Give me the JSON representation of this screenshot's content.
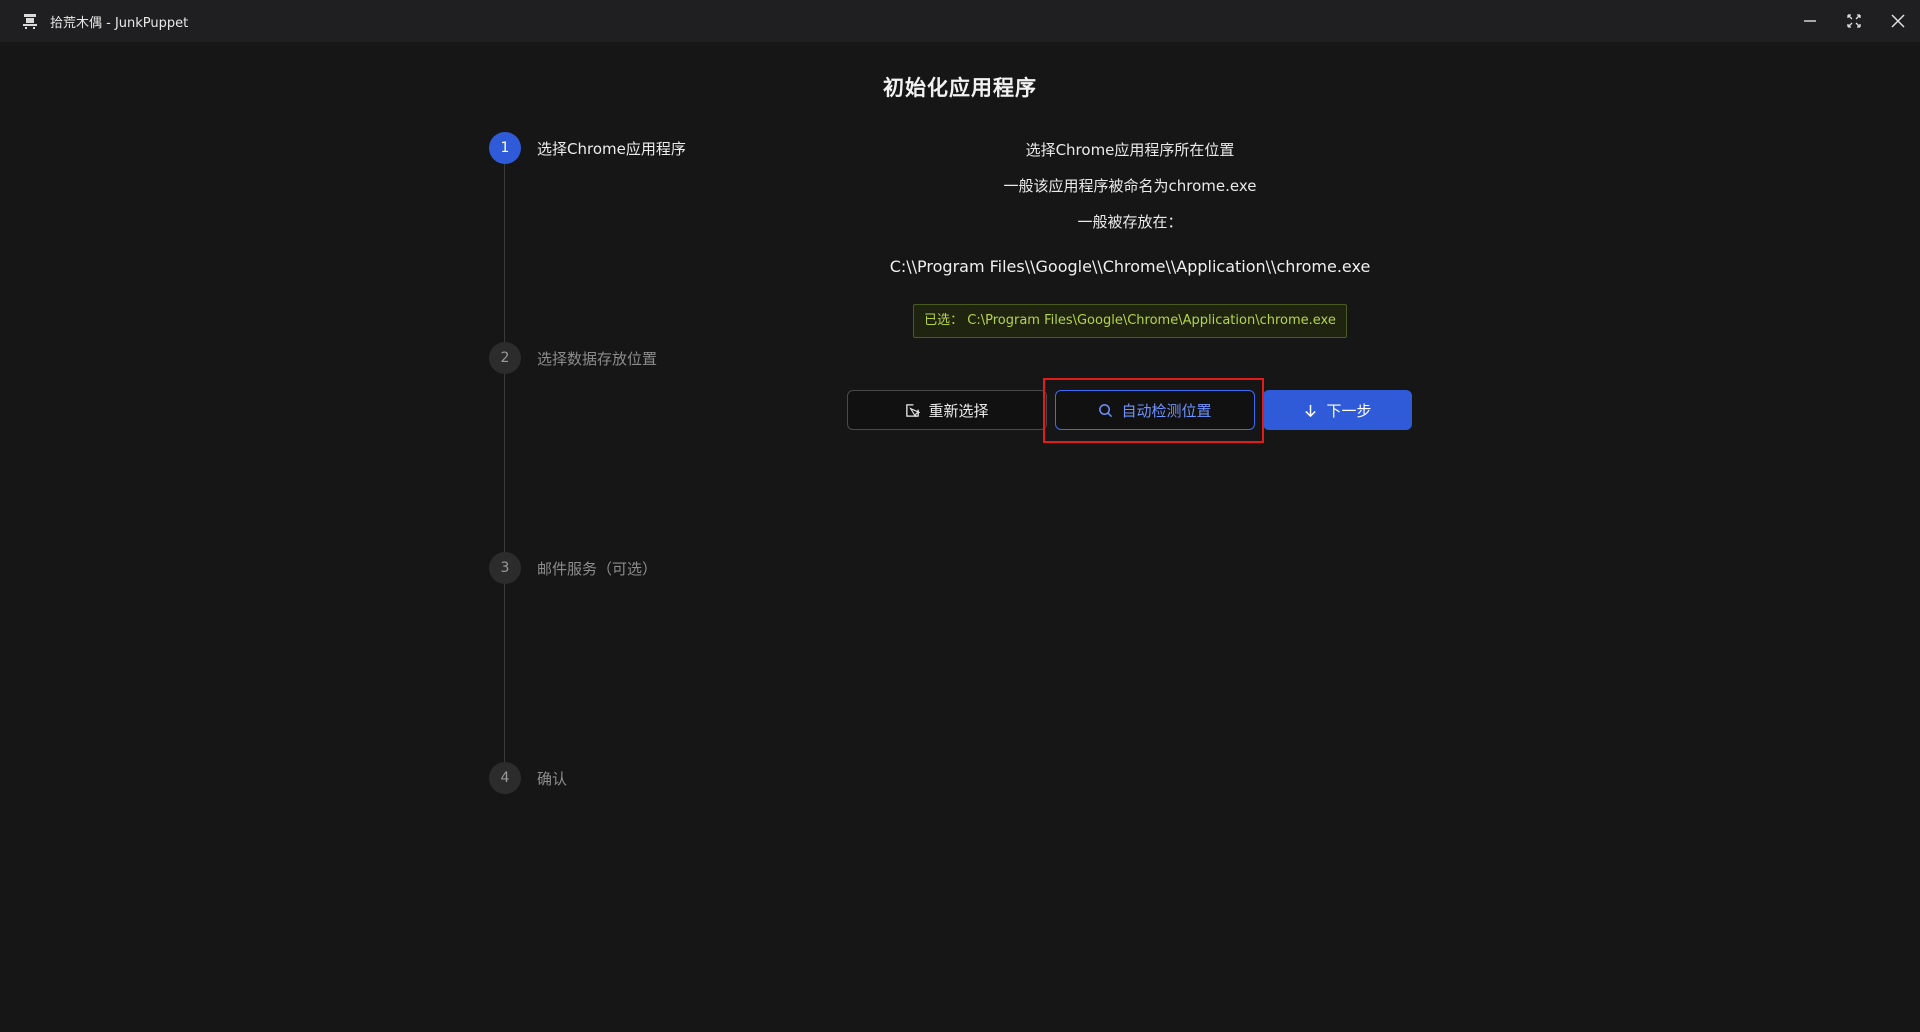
{
  "window": {
    "title": "拾荒木偶 - JunkPuppet",
    "logo_icon": "puppet-logo-icon",
    "controls": [
      "minimize-icon",
      "maximize-icon",
      "close-icon"
    ]
  },
  "page": {
    "title": "初始化应用程序"
  },
  "steps": [
    {
      "number": "1",
      "label": "选择Chrome应用程序",
      "active": true
    },
    {
      "number": "2",
      "label": "选择数据存放位置",
      "active": false
    },
    {
      "number": "3",
      "label": "邮件服务（可选）",
      "active": false
    },
    {
      "number": "4",
      "label": "确认",
      "active": false
    }
  ],
  "content": {
    "line1": "选择Chrome应用程序所在位置",
    "line2": "一般该应用程序被命名为chrome.exe",
    "line3": "一般被存放在：",
    "default_path": "C:\\\\Program Files\\\\Google\\\\Chrome\\\\Application\\\\chrome.exe",
    "selected": "已选： C:\\Program Files\\Google\\Chrome\\Application\\chrome.exe"
  },
  "buttons": {
    "reselect": "重新选择",
    "auto_detect": "自动检测位置",
    "next": "下一步"
  },
  "colors": {
    "accent": "#2f5bd8",
    "selected_text": "#b7d34a",
    "highlight": "#e21b1b"
  }
}
